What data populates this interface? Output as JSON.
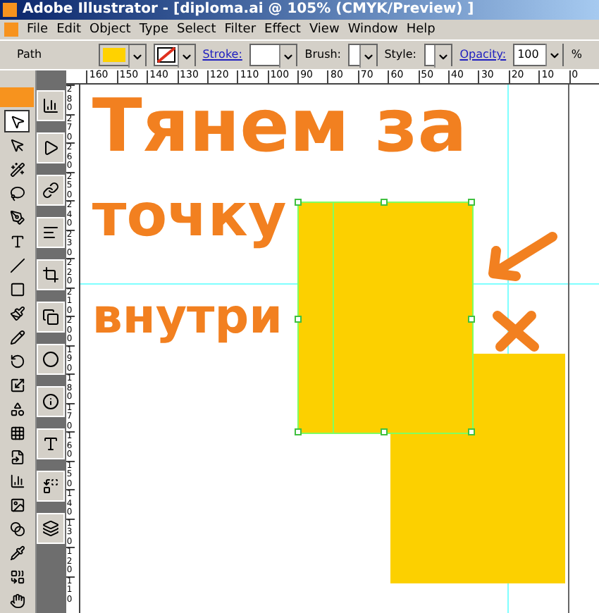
{
  "window": {
    "title": "Adobe Illustrator - [diploma.ai @ 105% (CMYK/Preview) ]"
  },
  "menu": [
    "File",
    "Edit",
    "Object",
    "Type",
    "Select",
    "Filter",
    "Effect",
    "View",
    "Window",
    "Help"
  ],
  "control_bar": {
    "selection_label": "Path",
    "stroke_label": "Stroke:",
    "brush_label": "Brush:",
    "style_label": "Style:",
    "opacity_label": "Opacity:",
    "opacity_value": "100",
    "opacity_unit": "%"
  },
  "tools": [
    {
      "selected": true
    },
    {
      "selected": false
    },
    {
      "selected": false
    },
    {
      "selected": false
    },
    {
      "selected": false
    },
    {
      "selected": false
    },
    {
      "selected": false
    },
    {
      "selected": false
    },
    {
      "selected": false
    },
    {
      "selected": false
    },
    {
      "selected": false
    },
    {
      "selected": false
    },
    {
      "selected": false
    },
    {
      "selected": false
    },
    {
      "selected": false
    },
    {
      "selected": false
    },
    {
      "selected": false
    },
    {
      "selected": false
    },
    {
      "selected": false
    },
    {
      "selected": false
    },
    {
      "selected": false
    }
  ],
  "horizontal_ruler": [
    "160",
    "150",
    "140",
    "130",
    "120",
    "110",
    "100",
    "90",
    "80",
    "70",
    "60",
    "50",
    "40",
    "30",
    "20",
    "10",
    "0"
  ],
  "vertical_ruler": [
    "280",
    "270",
    "260",
    "250",
    "240",
    "230",
    "220",
    "210",
    "200",
    "190",
    "180",
    "170",
    "160",
    "150",
    "140",
    "130",
    "120",
    "110"
  ],
  "annotation": [
    "Тянем за",
    "точку",
    "внутри"
  ]
}
